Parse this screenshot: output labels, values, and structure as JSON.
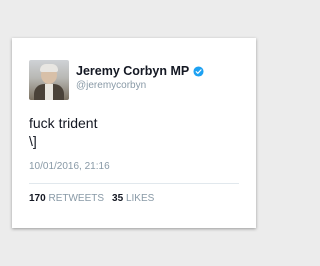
{
  "tweet": {
    "author_name": "Jeremy Corbyn MP",
    "handle": "@jeremycorbyn",
    "verified_icon": "verified-badge-icon",
    "text_lines": [
      "fuck trident",
      "\\]"
    ],
    "timestamp": "10/01/2016, 21:16",
    "retweet_count": "170",
    "retweet_label": "RETWEETS",
    "like_count": "35",
    "like_label": "LIKES"
  },
  "colors": {
    "background": "#ececec",
    "card": "#ffffff",
    "verified_blue": "#1da1f2",
    "muted_text": "#8899a6",
    "primary_text": "#141823"
  }
}
